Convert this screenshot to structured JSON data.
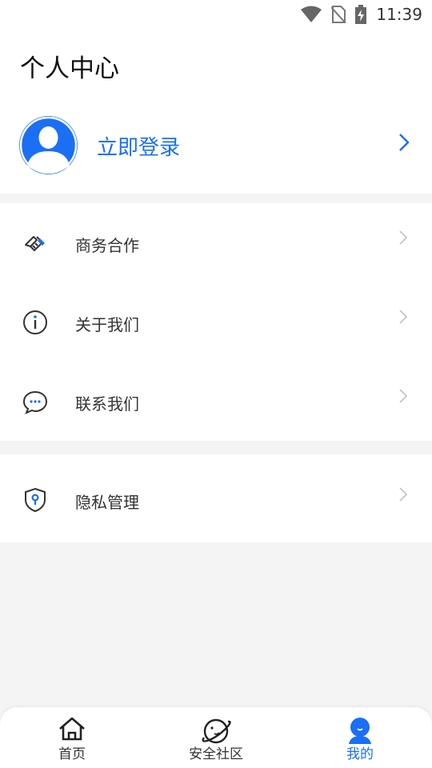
{
  "status_bar": {
    "time": "11:39",
    "icons": [
      "wifi-icon",
      "no-sim-icon",
      "battery-charging-icon"
    ]
  },
  "page": {
    "title": "个人中心"
  },
  "login": {
    "label": "立即登录",
    "avatar_icon": "user-avatar-icon"
  },
  "menu": {
    "group1": [
      {
        "label": "商务合作",
        "icon": "handshake-icon"
      },
      {
        "label": "关于我们",
        "icon": "info-icon"
      },
      {
        "label": "联系我们",
        "icon": "chat-icon"
      }
    ],
    "group2": [
      {
        "label": "隐私管理",
        "icon": "shield-key-icon"
      }
    ]
  },
  "bottom_nav": {
    "tabs": [
      {
        "label": "首页",
        "icon": "home-icon"
      },
      {
        "label": "安全社区",
        "icon": "planet-icon"
      },
      {
        "label": "我的",
        "icon": "profile-icon",
        "active": true
      }
    ]
  },
  "colors": {
    "accent": "#1a6ff5",
    "background": "#f4f4f4",
    "text": "#333333"
  }
}
